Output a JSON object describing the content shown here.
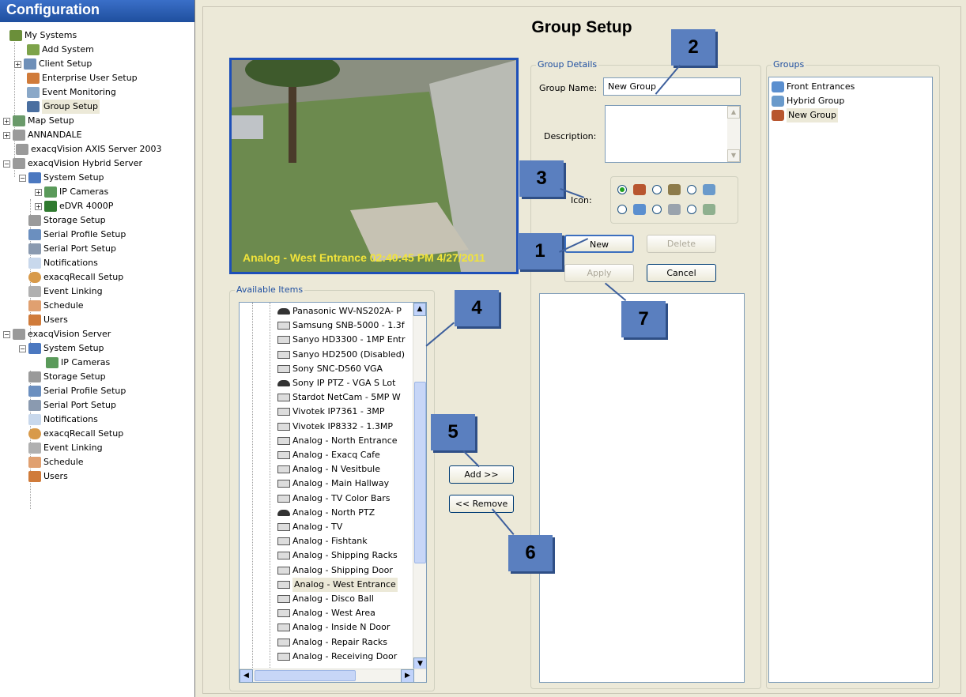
{
  "nav": {
    "title": "Configuration",
    "items": [
      {
        "label": "My Systems"
      },
      {
        "label": "Add System"
      },
      {
        "label": "Client Setup"
      },
      {
        "label": "Enterprise User Setup"
      },
      {
        "label": "Event Monitoring"
      },
      {
        "label": "Group Setup"
      },
      {
        "label": "Map Setup"
      },
      {
        "label": "ANNANDALE"
      },
      {
        "label": "exacqVision AXIS Server 2003"
      },
      {
        "label": "exacqVision Hybrid Server"
      },
      {
        "label": "System Setup"
      },
      {
        "label": "IP Cameras"
      },
      {
        "label": "eDVR 4000P"
      },
      {
        "label": "Storage Setup"
      },
      {
        "label": "Serial Profile Setup"
      },
      {
        "label": "Serial Port Setup"
      },
      {
        "label": "Notifications"
      },
      {
        "label": "exacqRecall Setup"
      },
      {
        "label": "Event Linking"
      },
      {
        "label": "Schedule"
      },
      {
        "label": "Users"
      },
      {
        "label": "exacqVision Server"
      },
      {
        "label": "System Setup"
      },
      {
        "label": "IP Cameras"
      },
      {
        "label": "Storage Setup"
      },
      {
        "label": "Serial Profile Setup"
      },
      {
        "label": "Serial Port Setup"
      },
      {
        "label": "Notifications"
      },
      {
        "label": "exacqRecall Setup"
      },
      {
        "label": "Event Linking"
      },
      {
        "label": "Schedule"
      },
      {
        "label": "Users"
      }
    ]
  },
  "main": {
    "title": "Group Setup",
    "video_overlay": "Analog - West Entrance 02:40:45 PM 4/27/2011",
    "available_items_legend": "Available Items",
    "available_items": [
      {
        "label": "Panasonic WV-NS202A- P",
        "type": "dome"
      },
      {
        "label": "Samsung SNB-5000 - 1.3f",
        "type": "box"
      },
      {
        "label": "Sanyo HD3300 - 1MP Entr",
        "type": "box"
      },
      {
        "label": "Sanyo HD2500 (Disabled)",
        "type": "box"
      },
      {
        "label": "Sony SNC-DS60 VGA",
        "type": "box"
      },
      {
        "label": "Sony IP PTZ - VGA S Lot",
        "type": "dome"
      },
      {
        "label": "Stardot NetCam - 5MP W",
        "type": "box"
      },
      {
        "label": "Vivotek IP7361 - 3MP",
        "type": "box"
      },
      {
        "label": "Vivotek IP8332 - 1.3MP",
        "type": "box"
      },
      {
        "label": "Analog - North Entrance",
        "type": "box"
      },
      {
        "label": "Analog - Exacq Cafe",
        "type": "box"
      },
      {
        "label": "Analog - N Vesitbule",
        "type": "box"
      },
      {
        "label": "Analog - Main Hallway",
        "type": "box"
      },
      {
        "label": "Analog - TV Color Bars",
        "type": "box"
      },
      {
        "label": "Analog - North PTZ",
        "type": "dome"
      },
      {
        "label": "Analog - TV",
        "type": "box"
      },
      {
        "label": "Analog - Fishtank",
        "type": "box"
      },
      {
        "label": "Analog - Shipping Racks",
        "type": "box"
      },
      {
        "label": "Analog - Shipping Door",
        "type": "box"
      },
      {
        "label": "Analog - West Entrance",
        "type": "box",
        "selected": true
      },
      {
        "label": "Analog - Disco Ball",
        "type": "box"
      },
      {
        "label": "Analog - West Area",
        "type": "box"
      },
      {
        "label": "Analog - Inside N Door",
        "type": "box"
      },
      {
        "label": "Analog - Repair Racks",
        "type": "box"
      },
      {
        "label": "Analog - Receiving Door",
        "type": "box"
      }
    ],
    "add_label": "Add >>",
    "remove_label": "<< Remove",
    "group_details": {
      "legend": "Group Details",
      "name_label": "Group Name:",
      "name_value": "New Group",
      "description_label": "Description:",
      "description_value": "",
      "icon_label": "Icon:",
      "new_label": "New",
      "delete_label": "Delete",
      "apply_label": "Apply",
      "cancel_label": "Cancel"
    },
    "groups": {
      "legend": "Groups",
      "items": [
        {
          "label": "Front Entrances",
          "icon": "door-icon"
        },
        {
          "label": "Hybrid Group",
          "icon": "house-icon"
        },
        {
          "label": "New Group",
          "icon": "people-icon",
          "selected": true
        }
      ]
    },
    "callouts": [
      "1",
      "2",
      "3",
      "4",
      "5",
      "6",
      "7"
    ]
  },
  "colors": {
    "accent": "#3a6fc8",
    "callout": "#5a7fbf",
    "overlay_text": "#f2e43a"
  }
}
